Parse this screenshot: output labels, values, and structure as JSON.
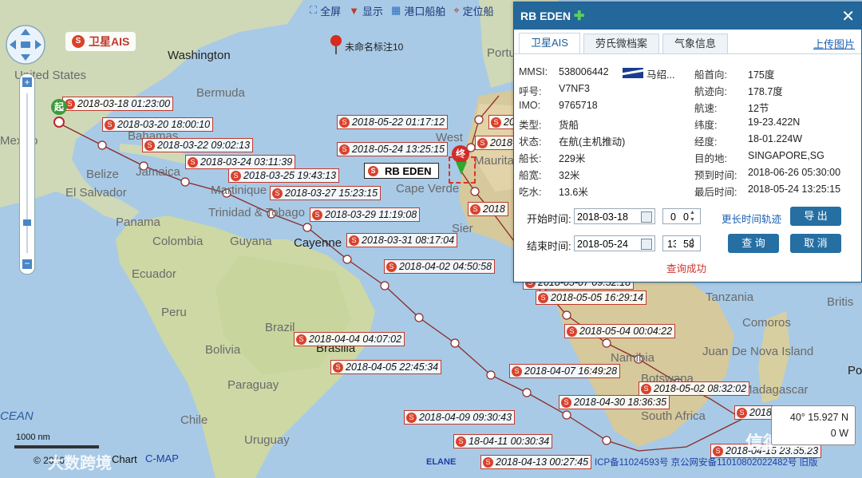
{
  "toolbar": {
    "fullscreen": "全屏",
    "display": "显示",
    "port_ships": "港口船舶",
    "locate": "定位船"
  },
  "map_labels": {
    "washington": "Washington",
    "united_states": "United States",
    "bermuda": "Bermuda",
    "mexico": "Mexico",
    "bahamas": "Bahamas",
    "jamaica": "Jamaica",
    "belize": "Belize",
    "el_salvador": "El Salvador",
    "panama": "Panama",
    "martinique": "Martinique",
    "trinidad": "Trinidad & Tobago",
    "colombia": "Colombia",
    "guyana": "Guyana",
    "cayenne": "Cayenne",
    "ecuador": "Ecuador",
    "peru": "Peru",
    "brazil": "Brazil",
    "bolivia": "Bolivia",
    "brasilia": "Brasilia",
    "paraguay": "Paraguay",
    "chile": "Chile",
    "uruguay": "Uruguay",
    "ocean": "CEAN",
    "west": "West",
    "mauritania": "Mauritai",
    "cape_verde": "Cape Verde",
    "sierra": "Sier",
    "tanzania": "Tanzania",
    "comoros": "Comoros",
    "juan_de_nova": "Juan De Nova Island",
    "namibia": "Namibia",
    "botswana": "Botswana",
    "madagascar": "Madagascar",
    "south_africa": "South Africa",
    "po": "Po",
    "briti": "Britis",
    "portu": "Portu",
    "unnamed_marker": "未命名标注10"
  },
  "brand": {
    "satellite_ais": "卫星AIS"
  },
  "markers": {
    "start": "起",
    "end": "终",
    "ship_name": "RB EDEN"
  },
  "track_labels": [
    "2018-03-18 01:23:00",
    "2018-03-20 18:00:10",
    "2018-03-22 09:02:13",
    "2018-03-24 03:11:39",
    "2018-03-25 19:43:13",
    "2018-03-27 15:23:15",
    "2018-03-29 11:19:08",
    "2018-03-31 08:17:04",
    "2018-04-02 04:50:58",
    "2018-04-04 04:07:02",
    "2018-04-05 22:45:34",
    "2018-04-09 09:30:43",
    "18-04-11 00:30:34",
    "2018-04-13 00:27:45",
    "2018-04-15 23:55:23",
    "2018-04-30 18:36:35",
    "2018-05-02 08:32:02",
    "2018-04-07 16:49:28",
    "2018-05-04 00:04:22",
    "2018-05-05 16:29:14",
    "2018-05-07 09:52:18",
    "2018-05-22 01:17:12",
    "2018-05-24 13:25:15",
    "2018-05",
    "2018-0",
    "2018-05-2",
    "2018"
  ],
  "scale": {
    "text": "1000 nm"
  },
  "footer": {
    "copyright": "© 2016",
    "chart": "Chart",
    "cmap": "C-MAP",
    "elane": "ELANE",
    "icp": "ICP备11024593号 京公网安备11010802022482号 旧版",
    "watermark_left": "大数跨境",
    "watermark_right": "信德海事"
  },
  "coords": {
    "lat": "40° 15.927 N",
    "lon": "0 W"
  },
  "panel": {
    "title": "RB EDEN",
    "tabs": [
      "卫星AIS",
      "劳氏微档案",
      "气象信息"
    ],
    "upload": "上传图片",
    "fields_left": [
      {
        "label": "MMSI:",
        "value": "538006442"
      },
      {
        "label": "呼号:",
        "value": "V7NF3"
      },
      {
        "label": "IMO:",
        "value": "9765718"
      },
      {
        "label": "类型:",
        "value": "货船"
      },
      {
        "label": "状态:",
        "value": "在航(主机推动)"
      },
      {
        "label": "船长:",
        "value": "229米"
      },
      {
        "label": "船宽:",
        "value": "32米"
      },
      {
        "label": "吃水:",
        "value": "13.6米"
      }
    ],
    "flag_country": "马绍...",
    "fields_right": [
      {
        "label": "船首向:",
        "value": "175度"
      },
      {
        "label": "航迹向:",
        "value": "178.7度"
      },
      {
        "label": "航速:",
        "value": "12节"
      },
      {
        "label": "纬度:",
        "value": "19-23.422N"
      },
      {
        "label": "经度:",
        "value": "18-01.224W"
      },
      {
        "label": "目的地:",
        "value": "SINGAPORE,SG"
      },
      {
        "label": "预到时间:",
        "value": "2018-06-26 05:30:00"
      },
      {
        "label": "最后时间:",
        "value": "2018-05-24 13:25:15"
      }
    ],
    "start_label": "开始时间:",
    "start_date": "2018-03-18",
    "start_h": "0",
    "start_m": "0",
    "longer_track": "更长时间轨迹",
    "export": "导 出",
    "end_label": "结束时间:",
    "end_date": "2018-05-24",
    "end_h": "13",
    "end_m": "58",
    "query": "查 询",
    "cancel": "取 消",
    "status": "查询成功"
  }
}
